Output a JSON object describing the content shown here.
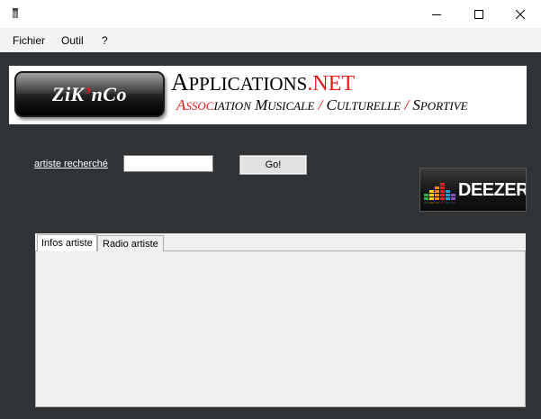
{
  "menu": {
    "items": [
      {
        "label": "Fichier"
      },
      {
        "label": "Outil"
      },
      {
        "label": "?"
      }
    ]
  },
  "banner": {
    "logo_text_part1": "ZiK",
    "logo_apostrophe": "’",
    "logo_text_part2": "nCo",
    "title_A": "A",
    "title_rest": "PPLICATIONS",
    "title_net": ".NET",
    "subtitle": {
      "assoc_big": "A",
      "assoc_small_red": "SSOC",
      "assoc_small_black": "IATION",
      "musicale_big": "M",
      "musicale_small": "USICALE",
      "sep1": "/",
      "culturelle_big": "C",
      "culturelle_small": "ULTURELLE",
      "sep2": "/",
      "sportive_big": "S",
      "sportive_small": "PORTIVE"
    },
    "colors": {
      "accent_red": "#e81818"
    }
  },
  "search": {
    "label": "artiste recherché",
    "value": "",
    "button_label": "Go!"
  },
  "deezer": {
    "word": "DEEZER",
    "icon": "deezer-equalizer-icon"
  },
  "tabs": [
    {
      "label": "Infos artiste",
      "active": true
    },
    {
      "label": "Radio artiste",
      "active": false
    }
  ],
  "window": {
    "icons": [
      "app-icon",
      "minimize-icon",
      "maximize-icon",
      "close-icon"
    ]
  }
}
